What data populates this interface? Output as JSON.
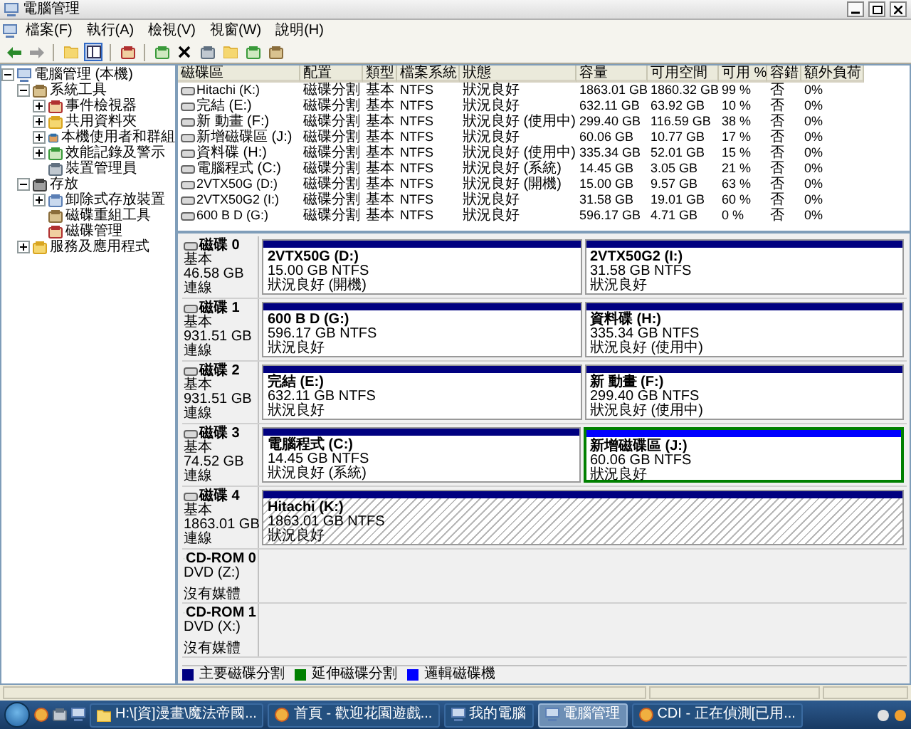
{
  "window": {
    "title": "電腦管理"
  },
  "menu": [
    "檔案(F)",
    "執行(A)",
    "檢視(V)",
    "視窗(W)",
    "說明(H)"
  ],
  "tree": [
    {
      "label": "電腦管理 (本機)",
      "expanded": true,
      "children": [
        {
          "label": "系統工具",
          "expanded": true,
          "children": [
            {
              "label": "事件檢視器",
              "expanded": false
            },
            {
              "label": "共用資料夾",
              "expanded": false
            },
            {
              "label": "本機使用者和群組",
              "expanded": false
            },
            {
              "label": "效能記錄及警示",
              "expanded": false
            },
            {
              "label": "裝置管理員"
            }
          ]
        },
        {
          "label": "存放",
          "expanded": true,
          "children": [
            {
              "label": "卸除式存放裝置",
              "expanded": false
            },
            {
              "label": "磁碟重組工具"
            },
            {
              "label": "磁碟管理"
            }
          ]
        },
        {
          "label": "服務及應用程式",
          "expanded": false
        }
      ]
    }
  ],
  "volumes": {
    "columns": [
      "磁碟區",
      "配置",
      "類型",
      "檔案系統",
      "狀態",
      "容量",
      "可用空間",
      "可用 %",
      "容錯",
      "額外負荷"
    ],
    "rows": [
      [
        "Hitachi (K:)",
        "磁碟分割",
        "基本",
        "NTFS",
        "狀況良好",
        "1863.01 GB",
        "1860.32 GB",
        "99 %",
        "否",
        "0%"
      ],
      [
        "完結 (E:)",
        "磁碟分割",
        "基本",
        "NTFS",
        "狀況良好",
        "632.11 GB",
        "63.92 GB",
        "10 %",
        "否",
        "0%"
      ],
      [
        "新 動畫 (F:)",
        "磁碟分割",
        "基本",
        "NTFS",
        "狀況良好 (使用中)",
        "299.40 GB",
        "116.59 GB",
        "38 %",
        "否",
        "0%"
      ],
      [
        "新增磁碟區 (J:)",
        "磁碟分割",
        "基本",
        "NTFS",
        "狀況良好",
        "60.06 GB",
        "10.77 GB",
        "17 %",
        "否",
        "0%"
      ],
      [
        "資料碟 (H:)",
        "磁碟分割",
        "基本",
        "NTFS",
        "狀況良好 (使用中)",
        "335.34 GB",
        "52.01 GB",
        "15 %",
        "否",
        "0%"
      ],
      [
        "電腦程式 (C:)",
        "磁碟分割",
        "基本",
        "NTFS",
        "狀況良好 (系統)",
        "14.45 GB",
        "3.05 GB",
        "21 %",
        "否",
        "0%"
      ],
      [
        "2VTX50G (D:)",
        "磁碟分割",
        "基本",
        "NTFS",
        "狀況良好 (開機)",
        "15.00 GB",
        "9.57 GB",
        "63 %",
        "否",
        "0%"
      ],
      [
        "2VTX50G2 (I:)",
        "磁碟分割",
        "基本",
        "NTFS",
        "狀況良好",
        "31.58 GB",
        "19.01 GB",
        "60 %",
        "否",
        "0%"
      ],
      [
        "600 B D (G:)",
        "磁碟分割",
        "基本",
        "NTFS",
        "狀況良好",
        "596.17 GB",
        "4.71 GB",
        "0 %",
        "否",
        "0%"
      ]
    ]
  },
  "disks": [
    {
      "kind": "disk",
      "name": "磁碟 0",
      "type": "基本",
      "size": "46.58 GB",
      "status": "連線",
      "partitions": [
        {
          "name": "2VTX50G  (D:)",
          "size": "15.00 GB NTFS",
          "status": "狀況良好 (開機)",
          "kind": "primary",
          "selected": false
        },
        {
          "name": "2VTX50G2  (I:)",
          "size": "31.58 GB NTFS",
          "status": "狀況良好",
          "kind": "primary",
          "selected": false
        }
      ]
    },
    {
      "kind": "disk",
      "name": "磁碟 1",
      "type": "基本",
      "size": "931.51 GB",
      "status": "連線",
      "partitions": [
        {
          "name": "600 B D  (G:)",
          "size": "596.17 GB NTFS",
          "status": "狀況良好",
          "kind": "primary",
          "selected": false
        },
        {
          "name": "資料碟  (H:)",
          "size": "335.34 GB NTFS",
          "status": "狀況良好 (使用中)",
          "kind": "primary",
          "selected": false
        }
      ]
    },
    {
      "kind": "disk",
      "name": "磁碟 2",
      "type": "基本",
      "size": "931.51 GB",
      "status": "連線",
      "partitions": [
        {
          "name": "完結  (E:)",
          "size": "632.11 GB NTFS",
          "status": "狀況良好",
          "kind": "primary",
          "selected": false
        },
        {
          "name": "新 動畫  (F:)",
          "size": "299.40 GB NTFS",
          "status": "狀況良好 (使用中)",
          "kind": "primary",
          "selected": false
        }
      ]
    },
    {
      "kind": "disk",
      "name": "磁碟 3",
      "type": "基本",
      "size": "74.52 GB",
      "status": "連線",
      "partitions": [
        {
          "name": "電腦程式  (C:)",
          "size": "14.45 GB NTFS",
          "status": "狀況良好 (系統)",
          "kind": "primary",
          "selected": false
        },
        {
          "name": "新增磁碟區  (J:)",
          "size": "60.06 GB NTFS",
          "status": "狀況良好",
          "kind": "logical",
          "selected": false
        }
      ]
    },
    {
      "kind": "disk",
      "name": "磁碟 4",
      "type": "基本",
      "size": "1863.01 GB",
      "status": "連線",
      "partitions": [
        {
          "name": "Hitachi  (K:)",
          "size": "1863.01 GB NTFS",
          "status": "狀況良好",
          "kind": "primary",
          "selected": true
        }
      ]
    },
    {
      "kind": "cdrom",
      "name": "CD-ROM 0",
      "type": "DVD (Z:)",
      "status": "沒有媒體"
    },
    {
      "kind": "cdrom",
      "name": "CD-ROM 1",
      "type": "DVD (X:)",
      "status": "沒有媒體"
    }
  ],
  "legend": [
    {
      "label": "主要磁碟分割",
      "color": "#000080"
    },
    {
      "label": "延伸磁碟分割",
      "color": "#008000"
    },
    {
      "label": "邏輯磁碟機",
      "color": "#0000ff"
    }
  ],
  "taskbar": [
    {
      "label": "H:\\[資]漫畫\\魔法帝國...",
      "selected": false
    },
    {
      "label": "首頁 - 歡迎花園遊戲...",
      "selected": false
    },
    {
      "label": "我的電腦",
      "selected": false
    },
    {
      "label": "電腦管理",
      "selected": true
    },
    {
      "label": "CDI - 正在偵測[已用...",
      "selected": false
    }
  ]
}
